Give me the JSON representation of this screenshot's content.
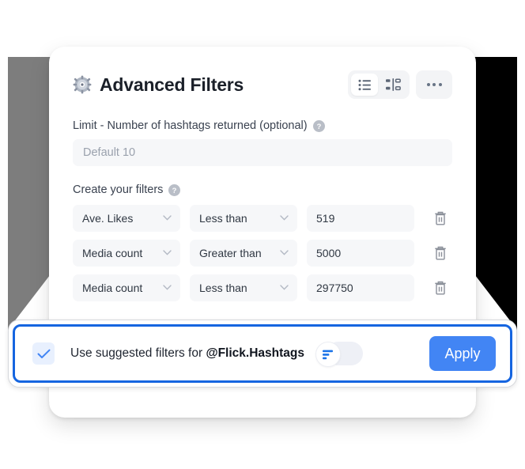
{
  "header": {
    "title": "Advanced Filters",
    "gear_icon": "gear-icon",
    "view_list_icon": "list-view-icon",
    "view_filter_icon": "filter-settings-icon",
    "more_icon": "more-options-icon"
  },
  "limit": {
    "label": "Limit - Number of hashtags returned (optional)",
    "help_icon": "help-circle-icon",
    "placeholder": "Default 10",
    "value": ""
  },
  "filters_section": {
    "label": "Create your filters",
    "help_icon": "help-circle-icon",
    "delete_icon": "trash-icon",
    "chevron_icon": "chevron-down-icon",
    "rows": [
      {
        "metric": "Ave. Likes",
        "operator": "Less than",
        "value": "519"
      },
      {
        "metric": "Media count",
        "operator": "Greater than",
        "value": "5000"
      },
      {
        "metric": "Media count",
        "operator": "Less than",
        "value": "297750"
      }
    ]
  },
  "suggestion_bar": {
    "checkbox_icon": "check-icon",
    "checked": true,
    "text_prefix": "Use suggested filters for ",
    "account": "@Flick.Hashtags",
    "toggle_icon": "filter-icon",
    "toggle_on": false,
    "apply_label": "Apply"
  },
  "colors": {
    "accent_blue": "#4285f4",
    "highlight_border": "#1565e0",
    "checkbox_bg": "#e8f0fe",
    "field_bg": "#f6f7f9",
    "ribbon_left": "#7d7d7d",
    "ribbon_right": "#000000"
  }
}
